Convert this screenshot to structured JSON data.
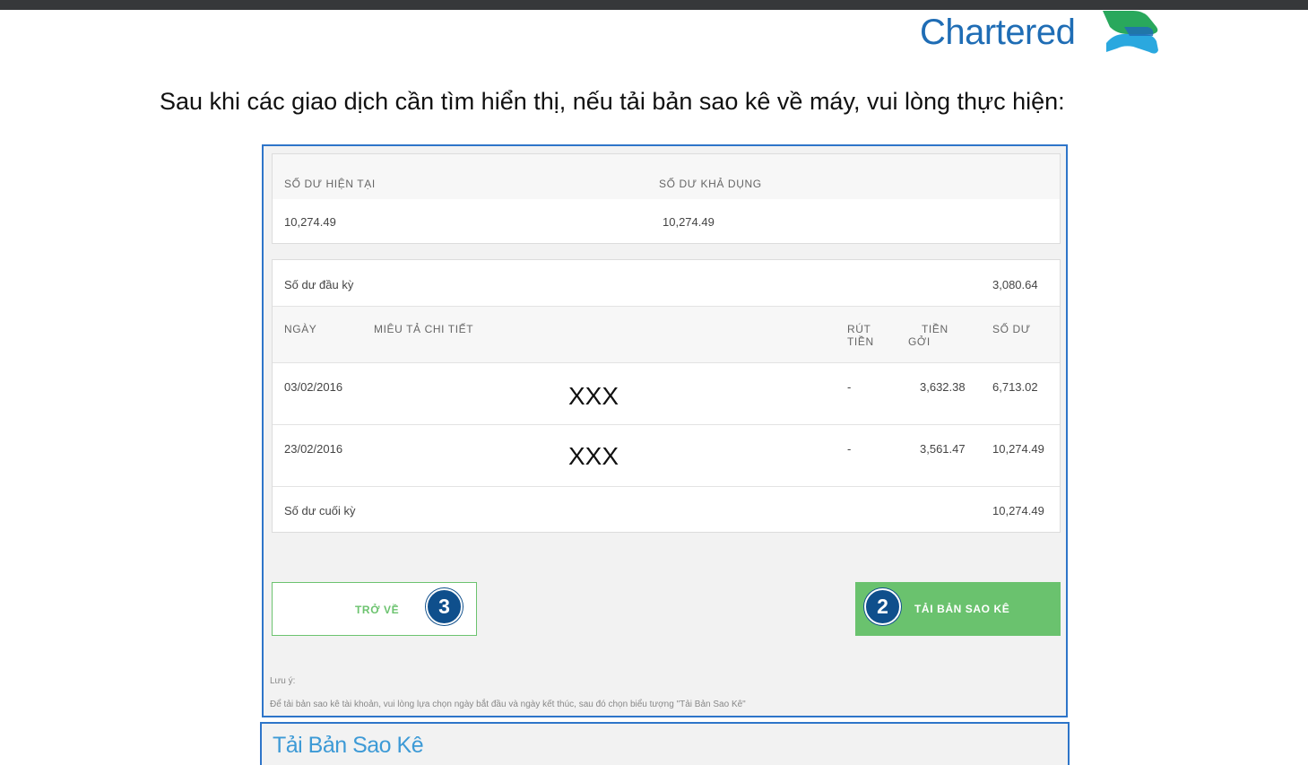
{
  "logo": {
    "text": "Chartered",
    "mark_icon": "standard-chartered-logo-mark",
    "brand_color": "#1f6db5"
  },
  "instruction": "Sau khi các giao dịch cần tìm hiển thị, nếu tải bản sao kê về máy, vui lòng thực hiện:",
  "balance": {
    "current_label": "SỐ DƯ HIỆN TẠI",
    "available_label": "SỐ DƯ KHẢ DỤNG",
    "current_value": "10,274.49",
    "available_value": "10,274.49"
  },
  "statement": {
    "opening_label": "Số dư đầu kỳ",
    "opening_value": "3,080.64",
    "columns": {
      "date": "NGÀY",
      "description": "MIÊU TẢ CHI TIẾT",
      "withdraw_line1": "RÚT",
      "withdraw_line2": "TIỀN",
      "deposit_line1": "TIỀN",
      "deposit_line2": "GỞI",
      "balance": "SỐ DƯ"
    },
    "rows": [
      {
        "date": "03/02/2016",
        "description": "XXX",
        "withdraw": "-",
        "deposit": "3,632.38",
        "balance": "6,713.02"
      },
      {
        "date": "23/02/2016",
        "description": "XXX",
        "withdraw": "-",
        "deposit": "3,561.47",
        "balance": "10,274.49"
      }
    ],
    "closing_label": "Số dư cuối kỳ",
    "closing_value": "10,274.49"
  },
  "buttons": {
    "back_label": "TRỞ VỀ",
    "back_step": "3",
    "download_label": "TẢI BẢN SAO KÊ",
    "download_step": "2",
    "accent_color": "#6ac26e"
  },
  "note": {
    "title": "Lưu ý:",
    "text": "Để tải bản sao kê tài khoản, vui lòng lựa chọn ngày bắt đầu và ngày kết thúc, sau đó chọn biểu tượng \"Tải Bản Sao Kê\""
  },
  "section2": {
    "title": "Tải Bản Sao Kê"
  }
}
